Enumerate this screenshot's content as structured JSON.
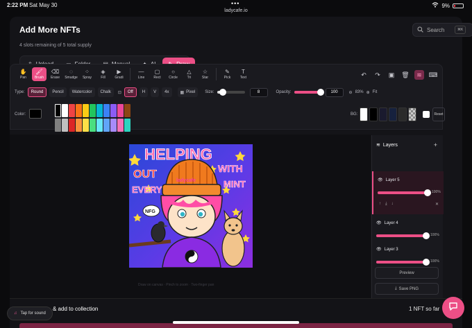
{
  "status": {
    "time": "2:22 PM",
    "date": "Sat May 30",
    "url": "ladycafe.io",
    "battery": "9%"
  },
  "header": {
    "title": "Add More NFTs",
    "subtitle": "4 slots remaining of 5 total supply",
    "search_label": "Search",
    "search_shortcut": "⌘K"
  },
  "modes": [
    {
      "label": "Upload",
      "icon": "upload-icon"
    },
    {
      "label": "Folder",
      "icon": "folder-icon"
    },
    {
      "label": "Manual",
      "icon": "document-icon"
    },
    {
      "label": "AI",
      "icon": "sparkle-icon"
    },
    {
      "label": "Draw",
      "icon": "brush-icon",
      "active": true
    }
  ],
  "tools": [
    {
      "label": "Pan",
      "glyph": "✋"
    },
    {
      "label": "Brush",
      "glyph": "🖌",
      "active": true
    },
    {
      "label": "Erase",
      "glyph": "⌫"
    },
    {
      "label": "Smudge",
      "glyph": "◌"
    },
    {
      "label": "Spray",
      "glyph": "⁘"
    },
    {
      "label": "Fill",
      "glyph": "◈"
    },
    {
      "label": "Gradi",
      "glyph": "▶"
    },
    {
      "label": "Line",
      "glyph": "—"
    },
    {
      "label": "Rect",
      "glyph": "▢"
    },
    {
      "label": "Circle",
      "glyph": "○"
    },
    {
      "label": "Tri",
      "glyph": "△"
    },
    {
      "label": "Star",
      "glyph": "☆"
    },
    {
      "label": "Pick",
      "glyph": "✎"
    },
    {
      "label": "Text",
      "glyph": "T"
    }
  ],
  "brush": {
    "type_label": "Type:",
    "types": [
      "Round",
      "Pencil",
      "Watercolor",
      "Chalk"
    ],
    "selected_type": "Round",
    "symmetry": "Off",
    "symmetry_options": [
      "H",
      "V",
      "4x"
    ],
    "pixel_label": "Pixel",
    "size_label": "Size:",
    "size": "8",
    "size_level": 0.2,
    "opacity_label": "Opacity:",
    "opacity": "100",
    "opacity_level": 1.0,
    "zoom": "83%",
    "fit_label": "Fit"
  },
  "colors": {
    "label": "Color:",
    "current": "#000000",
    "palette": [
      "#000000",
      "#ffffff",
      "#ef4444",
      "#f97316",
      "#facc15",
      "#22c55e",
      "#06b6d4",
      "#3b82f6",
      "#8b5cf6",
      "#ec4899",
      "#8b4513",
      "#808080",
      "#c0c0c0",
      "#dc2626",
      "#fb923c",
      "#fde047",
      "#4ade80",
      "#67e8f9",
      "#60a5fa",
      "#a78bfa",
      "#f472b6",
      "#2dd4bf"
    ],
    "bg_label": "BG:",
    "bg_swatches": [
      "#ffffff",
      "#000000",
      "#1a1a2e",
      "#16213e",
      "#2a2a2a",
      "checker"
    ],
    "reset_label": "Reset"
  },
  "canvas_hint": "Draw on canvas · Pinch to zoom · Two-finger pan",
  "layers": {
    "title": "Layers",
    "items": [
      {
        "name": "Layer 5",
        "opacity": "100%",
        "level": 1.0,
        "active": true
      },
      {
        "name": "Layer 4",
        "opacity": "100%",
        "level": 1.0
      },
      {
        "name": "Layer 3",
        "opacity": "100%",
        "level": 1.0
      }
    ],
    "preview_label": "Preview",
    "save_label": "Save PNG"
  },
  "artwork_text": [
    "HELPING",
    "OUT",
    "WITH",
    "EVERY",
    "MINT",
    "NFG",
    "ladycafe"
  ],
  "footer": {
    "add_label": "& add to collection",
    "count": "1 NFT so far",
    "sound_label": "Tap for sound"
  }
}
